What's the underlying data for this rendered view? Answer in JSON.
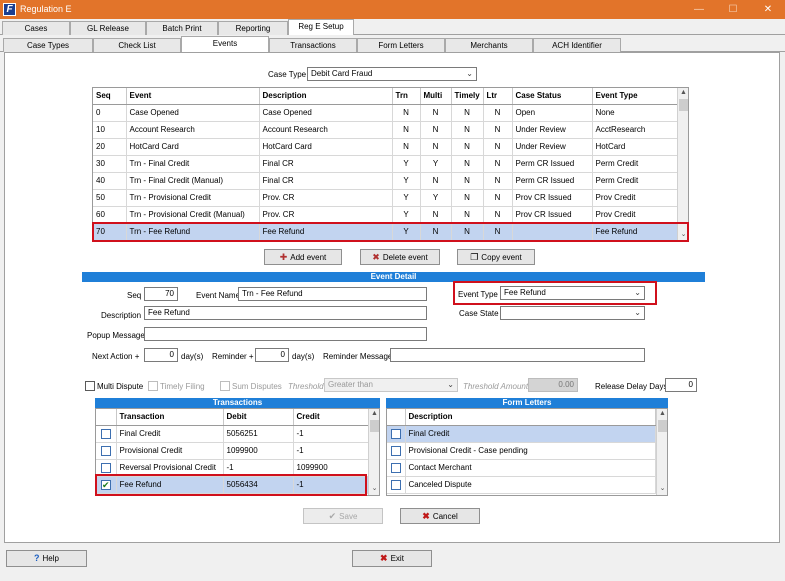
{
  "window": {
    "title": "Regulation E",
    "app_icon": "F"
  },
  "tabs_main": [
    "Cases",
    "GL Release",
    "Batch Print",
    "Reporting",
    "Reg E Setup"
  ],
  "tabs_sub": [
    "Case Types",
    "Check List",
    "Events",
    "Transactions",
    "Form Letters",
    "Merchants",
    "ACH Identifier"
  ],
  "case_type": {
    "label": "Case Type",
    "value": "Debit Card Fraud"
  },
  "events_grid": {
    "columns": [
      "Seq",
      "Event",
      "Description",
      "Trn",
      "Multi",
      "Timely",
      "Ltr",
      "Case Status",
      "Event Type"
    ],
    "rows": [
      [
        "0",
        "Case Opened",
        "Case Opened",
        "N",
        "N",
        "N",
        "N",
        "Open",
        "None"
      ],
      [
        "10",
        "Account Research",
        "Account Research",
        "N",
        "N",
        "N",
        "N",
        "Under Review",
        "AcctResearch"
      ],
      [
        "20",
        "HotCard Card",
        "HotCard Card",
        "N",
        "N",
        "N",
        "N",
        "Under Review",
        "HotCard"
      ],
      [
        "30",
        "Trn - Final Credit",
        "Final CR",
        "Y",
        "Y",
        "N",
        "N",
        "Perm CR Issued",
        "Perm Credit"
      ],
      [
        "40",
        "Trn - Final Credit (Manual)",
        "Final CR",
        "Y",
        "N",
        "N",
        "N",
        "Perm CR Issued",
        "Perm Credit"
      ],
      [
        "50",
        "Trn - Provisional Credit",
        "Prov. CR",
        "Y",
        "Y",
        "N",
        "N",
        "Prov CR Issued",
        "Prov Credit"
      ],
      [
        "60",
        "Trn - Provisional Credit (Manual)",
        "Prov. CR",
        "Y",
        "N",
        "N",
        "N",
        "Prov CR Issued",
        "Prov Credit"
      ],
      [
        "70",
        "Trn - Fee Refund",
        "Fee Refund",
        "Y",
        "N",
        "N",
        "N",
        "",
        "Fee Refund"
      ]
    ],
    "selected_row": 7
  },
  "buttons": {
    "add_event": "Add event",
    "delete_event": "Delete event",
    "copy_event": "Copy event",
    "save": "Save",
    "cancel": "Cancel",
    "help": "Help",
    "exit": "Exit"
  },
  "event_detail": {
    "title": "Event Detail",
    "seq_label": "Seq",
    "seq": "70",
    "event_name_label": "Event Name",
    "event_name": "Trn - Fee Refund",
    "description_label": "Description",
    "description": "Fee Refund",
    "popup_label": "Popup Message",
    "popup": "",
    "event_type_label": "Event Type",
    "event_type": "Fee Refund",
    "case_state_label": "Case State",
    "case_state": "",
    "next_action_label": "Next Action +",
    "next_action": "0",
    "days1": "day(s)",
    "reminder_label": "Reminder +",
    "reminder": "0",
    "days2": "day(s)",
    "reminder_msg_label": "Reminder Message",
    "reminder_msg": ""
  },
  "options": {
    "multi_dispute": "Multi Dispute",
    "timely_filing": "Timely Filing",
    "sum_disputes": "Sum Disputes",
    "threshold_label": "Threshold",
    "threshold": "Greater than",
    "threshold_amount_label": "Threshold Amount",
    "threshold_amount": "0.00",
    "release_delay_label": "Release Delay Days",
    "release_delay": "0"
  },
  "transactions": {
    "title": "Transactions",
    "columns": [
      "Transaction",
      "Debit",
      "Credit"
    ],
    "rows": [
      {
        "checked": false,
        "cells": [
          "Final Credit",
          "5056251",
          "-1"
        ]
      },
      {
        "checked": false,
        "cells": [
          "Provisional Credit",
          "1099900",
          "-1"
        ]
      },
      {
        "checked": false,
        "cells": [
          "Reversal Provisional Credit",
          "-1",
          "1099900"
        ]
      },
      {
        "checked": true,
        "cells": [
          "Fee Refund",
          "5056434",
          "-1"
        ]
      }
    ]
  },
  "form_letters": {
    "title": "Form Letters",
    "columns": [
      "Description"
    ],
    "rows": [
      "Final Credit",
      "Provisional Credit - Case pending",
      "Contact Merchant",
      "Canceled Dispute"
    ]
  }
}
